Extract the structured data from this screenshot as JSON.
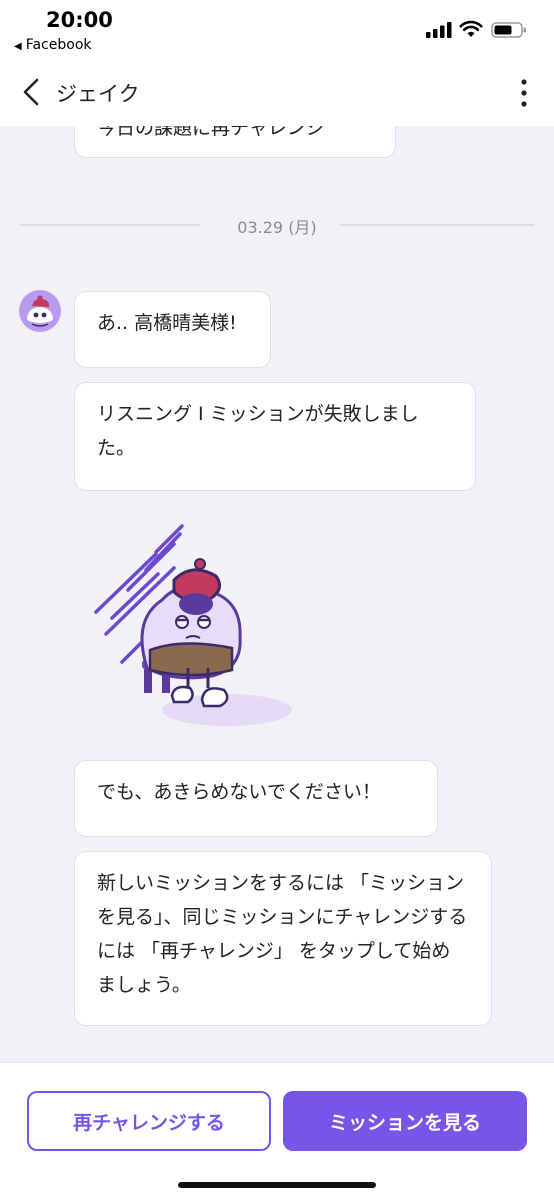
{
  "status_bar": {
    "time": "20:00",
    "back_app": "Facebook"
  },
  "nav": {
    "title": "ジェイク"
  },
  "chat": {
    "prev_message": "今日の課題に再チャレンジ",
    "date_separator": "03.29 (月)",
    "messages": [
      "あ.. 高橋晴美様!",
      "リスニング I ミッションが失敗しました。",
      "でも、あきらめないでください！",
      "新しいミッションをするには 「ミッションを見る」、同じミッションにチャレンジするには 「再チャレンジ」 をタップして始めましょう。"
    ]
  },
  "actions": {
    "retry_label": "再チャレンジする",
    "view_label": "ミッションを見る"
  },
  "colors": {
    "accent": "#7655e8",
    "background": "#f1f1f6"
  }
}
